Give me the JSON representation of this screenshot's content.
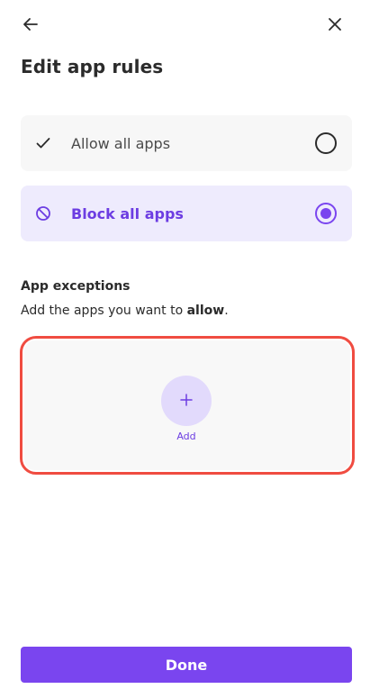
{
  "header": {
    "back_icon": "arrow-left-icon",
    "close_icon": "close-icon",
    "title": "Edit app rules"
  },
  "options": [
    {
      "label": "Allow all apps",
      "icon": "check-icon",
      "selected": false
    },
    {
      "label": "Block all apps",
      "icon": "block-icon",
      "selected": true
    }
  ],
  "exceptions": {
    "heading": "App exceptions",
    "description_prefix": "Add the apps you want to ",
    "description_emphasis": "allow",
    "description_suffix": ".",
    "add_label": "Add",
    "add_icon": "plus-icon"
  },
  "footer": {
    "done_label": "Done"
  },
  "colors": {
    "accent": "#7a45ef",
    "accent_text": "#6c3de2",
    "selected_bg": "#eeebfd",
    "highlight_outline": "#f04c41"
  }
}
